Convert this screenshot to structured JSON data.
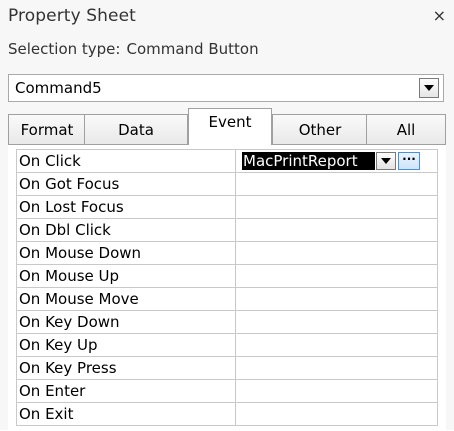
{
  "panel": {
    "title": "Property Sheet",
    "close_glyph": "×",
    "selection_type_label": "Selection type:",
    "selection_type_value": "Command Button",
    "object_name": "Command5"
  },
  "tabs": [
    {
      "label": "Format",
      "active": false
    },
    {
      "label": "Data",
      "active": false
    },
    {
      "label": "Event",
      "active": true
    },
    {
      "label": "Other",
      "active": false
    },
    {
      "label": "All",
      "active": false
    }
  ],
  "properties": [
    {
      "name": "On Click",
      "value": "MacPrintReport"
    },
    {
      "name": "On Got Focus",
      "value": ""
    },
    {
      "name": "On Lost Focus",
      "value": ""
    },
    {
      "name": "On Dbl Click",
      "value": ""
    },
    {
      "name": "On Mouse Down",
      "value": ""
    },
    {
      "name": "On Mouse Up",
      "value": ""
    },
    {
      "name": "On Mouse Move",
      "value": ""
    },
    {
      "name": "On Key Down",
      "value": ""
    },
    {
      "name": "On Key Up",
      "value": ""
    },
    {
      "name": "On Key Press",
      "value": ""
    },
    {
      "name": "On Enter",
      "value": ""
    },
    {
      "name": "On Exit",
      "value": ""
    }
  ],
  "builder_button_glyph": "···",
  "colors": {
    "selected_value_bg": "#000000",
    "builder_accent": "#4a90d9"
  },
  "icons": {
    "close": "close-icon",
    "dropdown": "chevron-down-icon",
    "builder": "ellipsis-icon"
  }
}
